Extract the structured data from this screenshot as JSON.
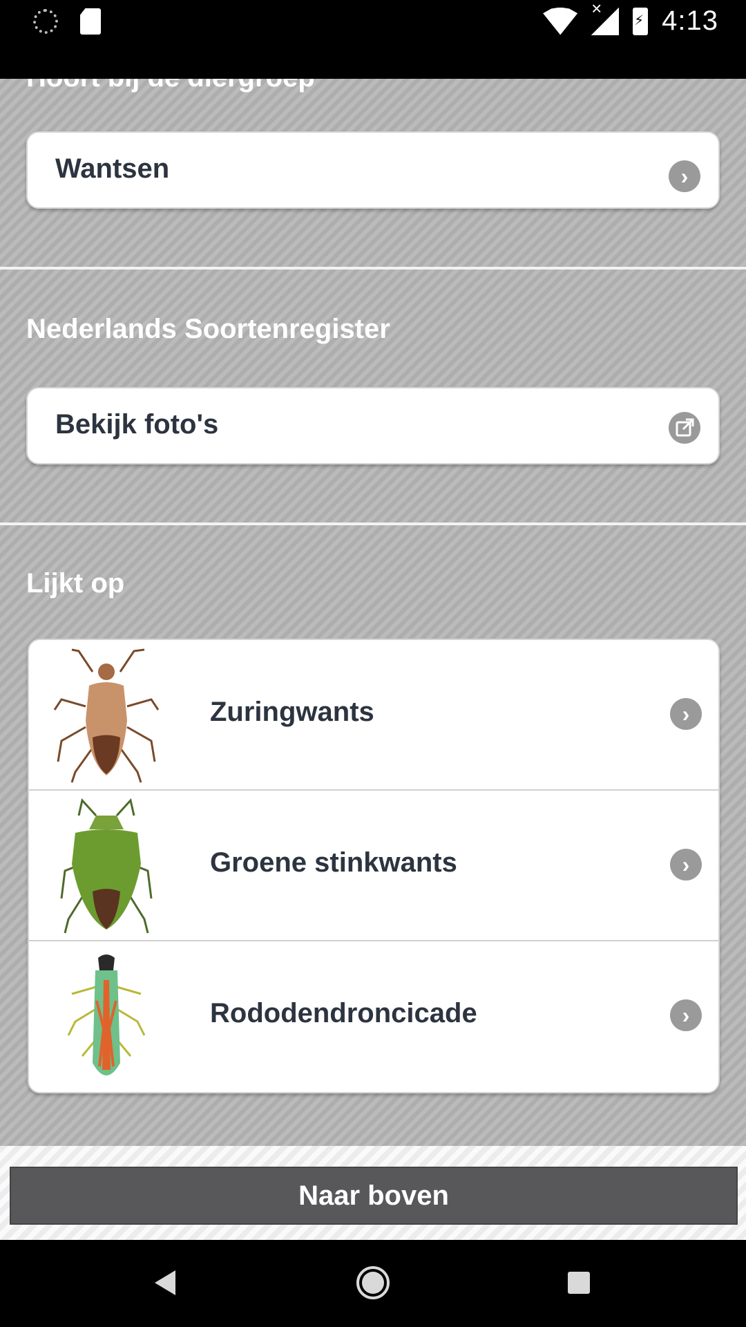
{
  "status_bar": {
    "time": "4:13",
    "left_icons": [
      "loading-spinner-icon",
      "sd-card-icon"
    ],
    "right_icons": [
      "wifi-icon",
      "signal-icon",
      "battery-charging-icon"
    ]
  },
  "sections": {
    "group": {
      "title": "Hoort bij de diergroep",
      "item_label": "Wantsen"
    },
    "register": {
      "title": "Nederlands Soortenregister",
      "item_label": "Bekijk foto's"
    },
    "similar": {
      "title": "Lijkt op",
      "items": [
        {
          "label": "Zuringwants",
          "icon": "chevron-right-icon"
        },
        {
          "label": "Groene stinkwants",
          "icon": "chevron-right-icon"
        },
        {
          "label": "Rododendroncicade",
          "icon": "chevron-right-icon"
        }
      ]
    }
  },
  "footer": {
    "top_button_label": "Naar boven"
  },
  "colors": {
    "background": "#b3b3b3",
    "card": "#ffffff",
    "text": "#2c3440",
    "button": "#58585a"
  }
}
